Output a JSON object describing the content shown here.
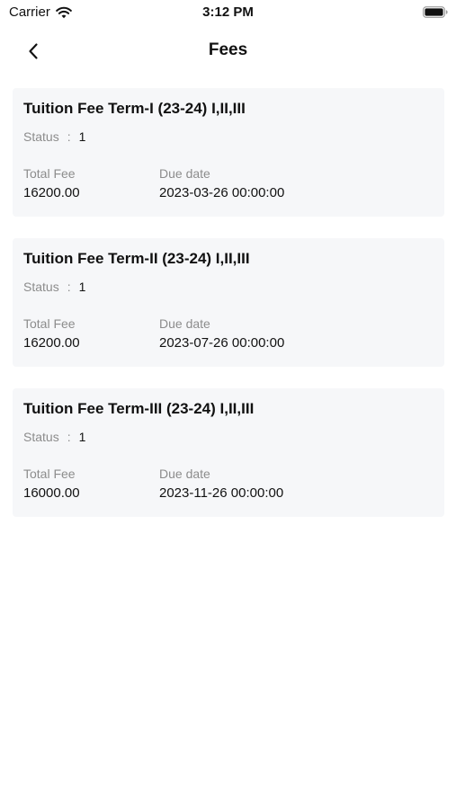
{
  "status_bar": {
    "carrier": "Carrier",
    "time": "3:12 PM",
    "wifi_icon": "wifi-icon",
    "battery_icon": "battery-icon"
  },
  "nav": {
    "back_icon": "chevron-left-icon",
    "title": "Fees"
  },
  "fees": [
    {
      "title": "Tuition Fee Term-I (23-24) I,II,III",
      "status_label": "Status",
      "status_separator": ":",
      "status_value": "1",
      "total_fee_label": "Total Fee",
      "total_fee_value": "16200.00",
      "due_date_label": "Due date",
      "due_date_value": "2023-03-26 00:00:00"
    },
    {
      "title": "Tuition Fee Term-II (23-24) I,II,III",
      "status_label": "Status",
      "status_separator": ":",
      "status_value": "1",
      "total_fee_label": "Total Fee",
      "total_fee_value": "16200.00",
      "due_date_label": "Due date",
      "due_date_value": "2023-07-26 00:00:00"
    },
    {
      "title": "Tuition Fee Term-III (23-24) I,II,III",
      "status_label": "Status",
      "status_separator": ":",
      "status_value": "1",
      "total_fee_label": "Total Fee",
      "total_fee_value": "16000.00",
      "due_date_label": "Due date",
      "due_date_value": "2023-11-26 00:00:00"
    }
  ]
}
